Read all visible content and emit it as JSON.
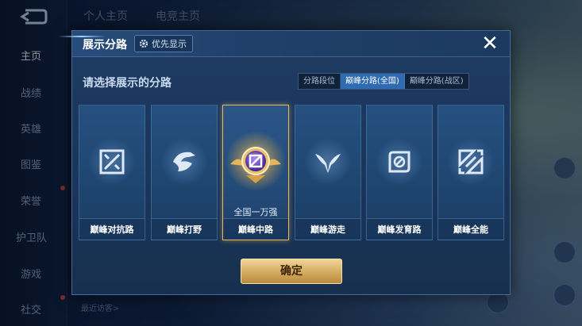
{
  "sidebar": {
    "back_icon": "back-arrow-icon",
    "items": [
      {
        "label": "主页"
      },
      {
        "label": "战绩"
      },
      {
        "label": "英雄"
      },
      {
        "label": "图鉴"
      },
      {
        "label": "荣誉"
      },
      {
        "label": "护卫队"
      },
      {
        "label": "游戏"
      },
      {
        "label": "社交"
      }
    ]
  },
  "topnav": [
    "个人主页",
    "电竞主页"
  ],
  "bottom_hint": "最近访客>",
  "modal": {
    "title": "展示分路",
    "pref_button": "优先显示",
    "subtitle": "请选择展示的分路",
    "tabs": [
      {
        "label": "分路段位",
        "active": false
      },
      {
        "label": "巅峰分路(全国)",
        "active": true
      },
      {
        "label": "巅峰分路(战区)",
        "active": false
      }
    ],
    "cards": [
      {
        "label": "巅峰对抗路",
        "icon": "clash-lane-icon",
        "selected": false,
        "rank": ""
      },
      {
        "label": "巅峰打野",
        "icon": "jungle-icon",
        "selected": false,
        "rank": ""
      },
      {
        "label": "巅峰中路",
        "icon": "mid-lane-icon",
        "selected": true,
        "rank": "全国一万强"
      },
      {
        "label": "巅峰游走",
        "icon": "roam-icon",
        "selected": false,
        "rank": ""
      },
      {
        "label": "巅峰发育路",
        "icon": "farm-lane-icon",
        "selected": false,
        "rank": ""
      },
      {
        "label": "巅峰全能",
        "icon": "all-round-icon",
        "selected": false,
        "rank": ""
      }
    ],
    "confirm_button": "确定"
  },
  "colors": {
    "accent": "#2e6bb0",
    "gold": "#e8b65a",
    "modal_bg": "#1e3b63"
  }
}
